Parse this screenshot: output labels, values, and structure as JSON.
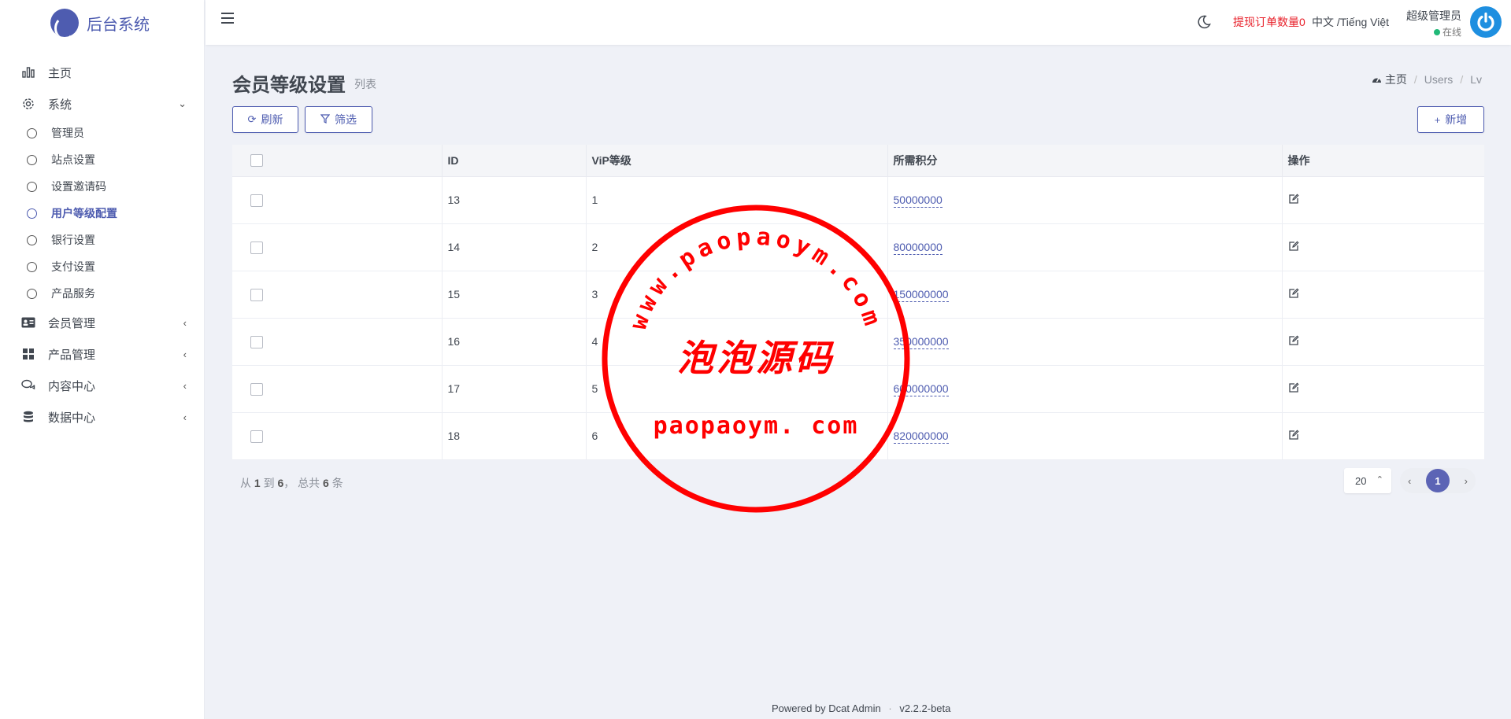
{
  "brand": {
    "name": "后台系统"
  },
  "sidebar": {
    "items": [
      {
        "label": "主页",
        "icon": "bar-chart-icon"
      },
      {
        "label": "系统",
        "icon": "gear-icon",
        "expanded": true
      },
      {
        "label": "会员管理",
        "icon": "id-card-icon"
      },
      {
        "label": "产品管理",
        "icon": "grid-icon"
      },
      {
        "label": "内容中心",
        "icon": "comments-icon"
      },
      {
        "label": "数据中心",
        "icon": "database-icon"
      }
    ],
    "sub_items": [
      {
        "label": "管理员"
      },
      {
        "label": "站点设置"
      },
      {
        "label": "设置邀请码"
      },
      {
        "label": "用户等级配置",
        "active": true
      },
      {
        "label": "银行设置"
      },
      {
        "label": "支付设置"
      },
      {
        "label": "产品服务"
      }
    ]
  },
  "topbar": {
    "withdraw_label": "提现订单数量0",
    "language": "中文 /Tiếng Việt",
    "user_name": "超级管理员",
    "user_status": "在线"
  },
  "page": {
    "title": "会员等级设置",
    "subtitle": "列表",
    "breadcrumb": {
      "home": "主页",
      "items": [
        "Users",
        "Lv"
      ]
    }
  },
  "toolbar": {
    "refresh_label": "刷新",
    "filter_label": "筛选",
    "add_label": "新增"
  },
  "table": {
    "columns": [
      "ID",
      "ViP等级",
      "所需积分",
      "操作"
    ],
    "rows": [
      {
        "id": "13",
        "level": "1",
        "points": "50000000"
      },
      {
        "id": "14",
        "level": "2",
        "points": "80000000"
      },
      {
        "id": "15",
        "level": "3",
        "points": "150000000"
      },
      {
        "id": "16",
        "level": "4",
        "points": "350000000"
      },
      {
        "id": "17",
        "level": "5",
        "points": "600000000"
      },
      {
        "id": "18",
        "level": "6",
        "points": "820000000"
      }
    ]
  },
  "pagination": {
    "summary_prefix": "从",
    "from": "1",
    "to_label": "到",
    "to": "6",
    "total_label": "， 总共",
    "total": "6",
    "unit": "条",
    "per_page": "20",
    "current_page": "1"
  },
  "watermark": {
    "arc_text": "www.paopaoym.com",
    "center_text": "泡泡源码",
    "bottom_text": "paopaoym. com",
    "color": "#ff0000"
  },
  "footer": {
    "powered": "Powered by Dcat Admin",
    "separator": "·",
    "version": "v2.2.2-beta"
  },
  "colors": {
    "primary": "#4e5cb0",
    "danger": "#e8202a",
    "online": "#21b978",
    "background": "#eff1f7"
  }
}
